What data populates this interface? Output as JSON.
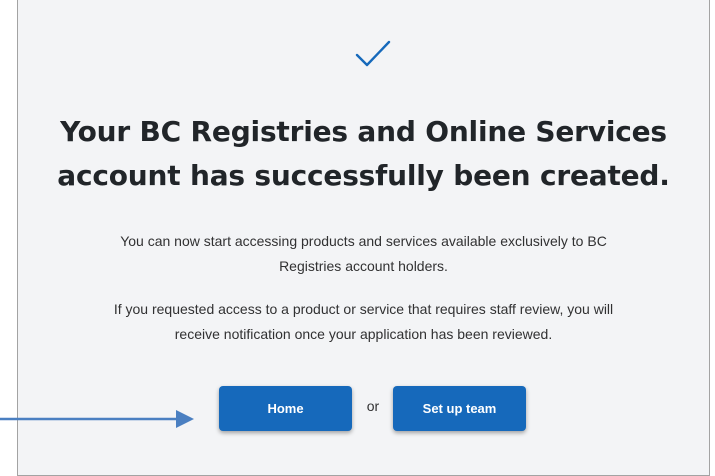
{
  "confirmation": {
    "title_line1": "Your BC Registries and Online Services",
    "title_line2": "account has successfully been created.",
    "paragraph1_line1": "You can now start accessing products and services available exclusively to BC",
    "paragraph1_line2": "Registries account holders.",
    "paragraph2_line1": "If you requested access to a product or service that requires staff review, you will",
    "paragraph2_line2": "receive notification once your application has been reviewed."
  },
  "actions": {
    "home_label": "Home",
    "or_label": "or",
    "team_label": "Set up team"
  },
  "colors": {
    "accent": "#1669bb",
    "background": "#f3f4f6",
    "title": "#212529",
    "arrow": "#4a7fc1"
  },
  "icons": {
    "success": "checkmark-icon",
    "annotation": "arrow-right-icon"
  }
}
